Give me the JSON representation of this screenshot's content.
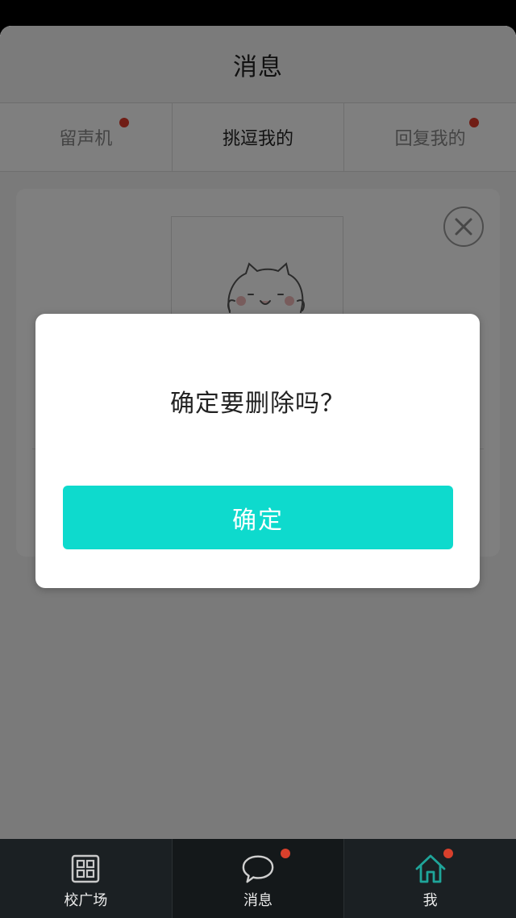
{
  "header": {
    "title": "消息"
  },
  "tabs": [
    {
      "label": "留声机",
      "active": false,
      "badge": true
    },
    {
      "label": "挑逗我的",
      "active": true,
      "badge": false
    },
    {
      "label": "回复我的",
      "active": false,
      "badge": true
    }
  ],
  "dialog": {
    "message": "确定要删除吗？",
    "confirm_label": "确定"
  },
  "tabbar": {
    "items": [
      {
        "label": "校广场",
        "icon": "grid-icon",
        "badge": false
      },
      {
        "label": "消息",
        "icon": "chat-bubble-icon",
        "badge": true
      },
      {
        "label": "我",
        "icon": "home-icon",
        "badge": true
      }
    ]
  },
  "colors": {
    "accent": "#0edacd",
    "badge": "#e03b2a",
    "tabbar_bg": "#1b2023",
    "home_icon": "#1fa59a"
  }
}
